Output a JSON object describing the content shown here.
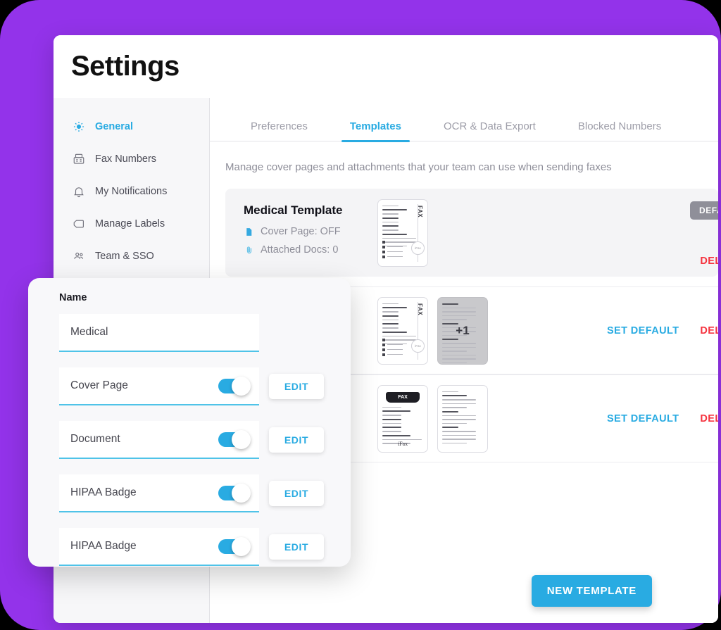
{
  "theme": {
    "backdrop_purple": "#9333ea",
    "accent_blue": "#29abe2",
    "danger_red": "#f5333f",
    "muted_gray": "#8e8e99"
  },
  "header": {
    "title": "Settings"
  },
  "sidebar": {
    "items": [
      {
        "label": "General",
        "icon": "gear-icon",
        "active": true
      },
      {
        "label": "Fax Numbers",
        "icon": "fax-machine-icon",
        "active": false
      },
      {
        "label": "My Notifications",
        "icon": "bell-icon",
        "active": false
      },
      {
        "label": "Manage Labels",
        "icon": "tag-icon",
        "active": false
      },
      {
        "label": "Team & SSO",
        "icon": "people-icon",
        "active": false
      }
    ]
  },
  "main": {
    "tabs": [
      {
        "label": "Preferences",
        "active": false
      },
      {
        "label": "Templates",
        "active": true
      },
      {
        "label": "OCR & Data Export",
        "active": false
      },
      {
        "label": "Blocked Numbers",
        "active": false
      }
    ],
    "description": "Manage cover pages and attachments that your team can use when sending faxes",
    "templates": [
      {
        "name": "Medical Template",
        "cover_page": "Cover Page: OFF",
        "attached_docs": "Attached Docs: 0",
        "default_badge": "DEFAULT",
        "delete_label": "DELETE",
        "set_default_label": ""
      },
      {
        "name": "",
        "cover_page": "",
        "attached_docs": "",
        "set_default_label": "SET DEFAULT",
        "delete_label": "DELETE",
        "extra_pages_label": "+1"
      },
      {
        "name": "",
        "cover_page": "",
        "attached_docs": "",
        "set_default_label": "SET DEFAULT",
        "delete_label": "DELETE"
      }
    ],
    "new_template_button": "NEW TEMPLATE"
  },
  "edit_panel": {
    "name_label": "Name",
    "name_value": "Medical",
    "edit_button": "EDIT",
    "rows": [
      {
        "label": "Cover Page",
        "toggle_on": true,
        "has_edit": true
      },
      {
        "label": "Document",
        "toggle_on": true,
        "has_edit": true
      },
      {
        "label": "HIPAA Badge",
        "toggle_on": true,
        "has_edit": true
      },
      {
        "label": "HIPAA Badge",
        "toggle_on": true,
        "has_edit": true
      }
    ]
  },
  "thumbnails": {
    "fax_label": "FAX",
    "ifax_label": "iFax",
    "circle_label": "iFax"
  }
}
